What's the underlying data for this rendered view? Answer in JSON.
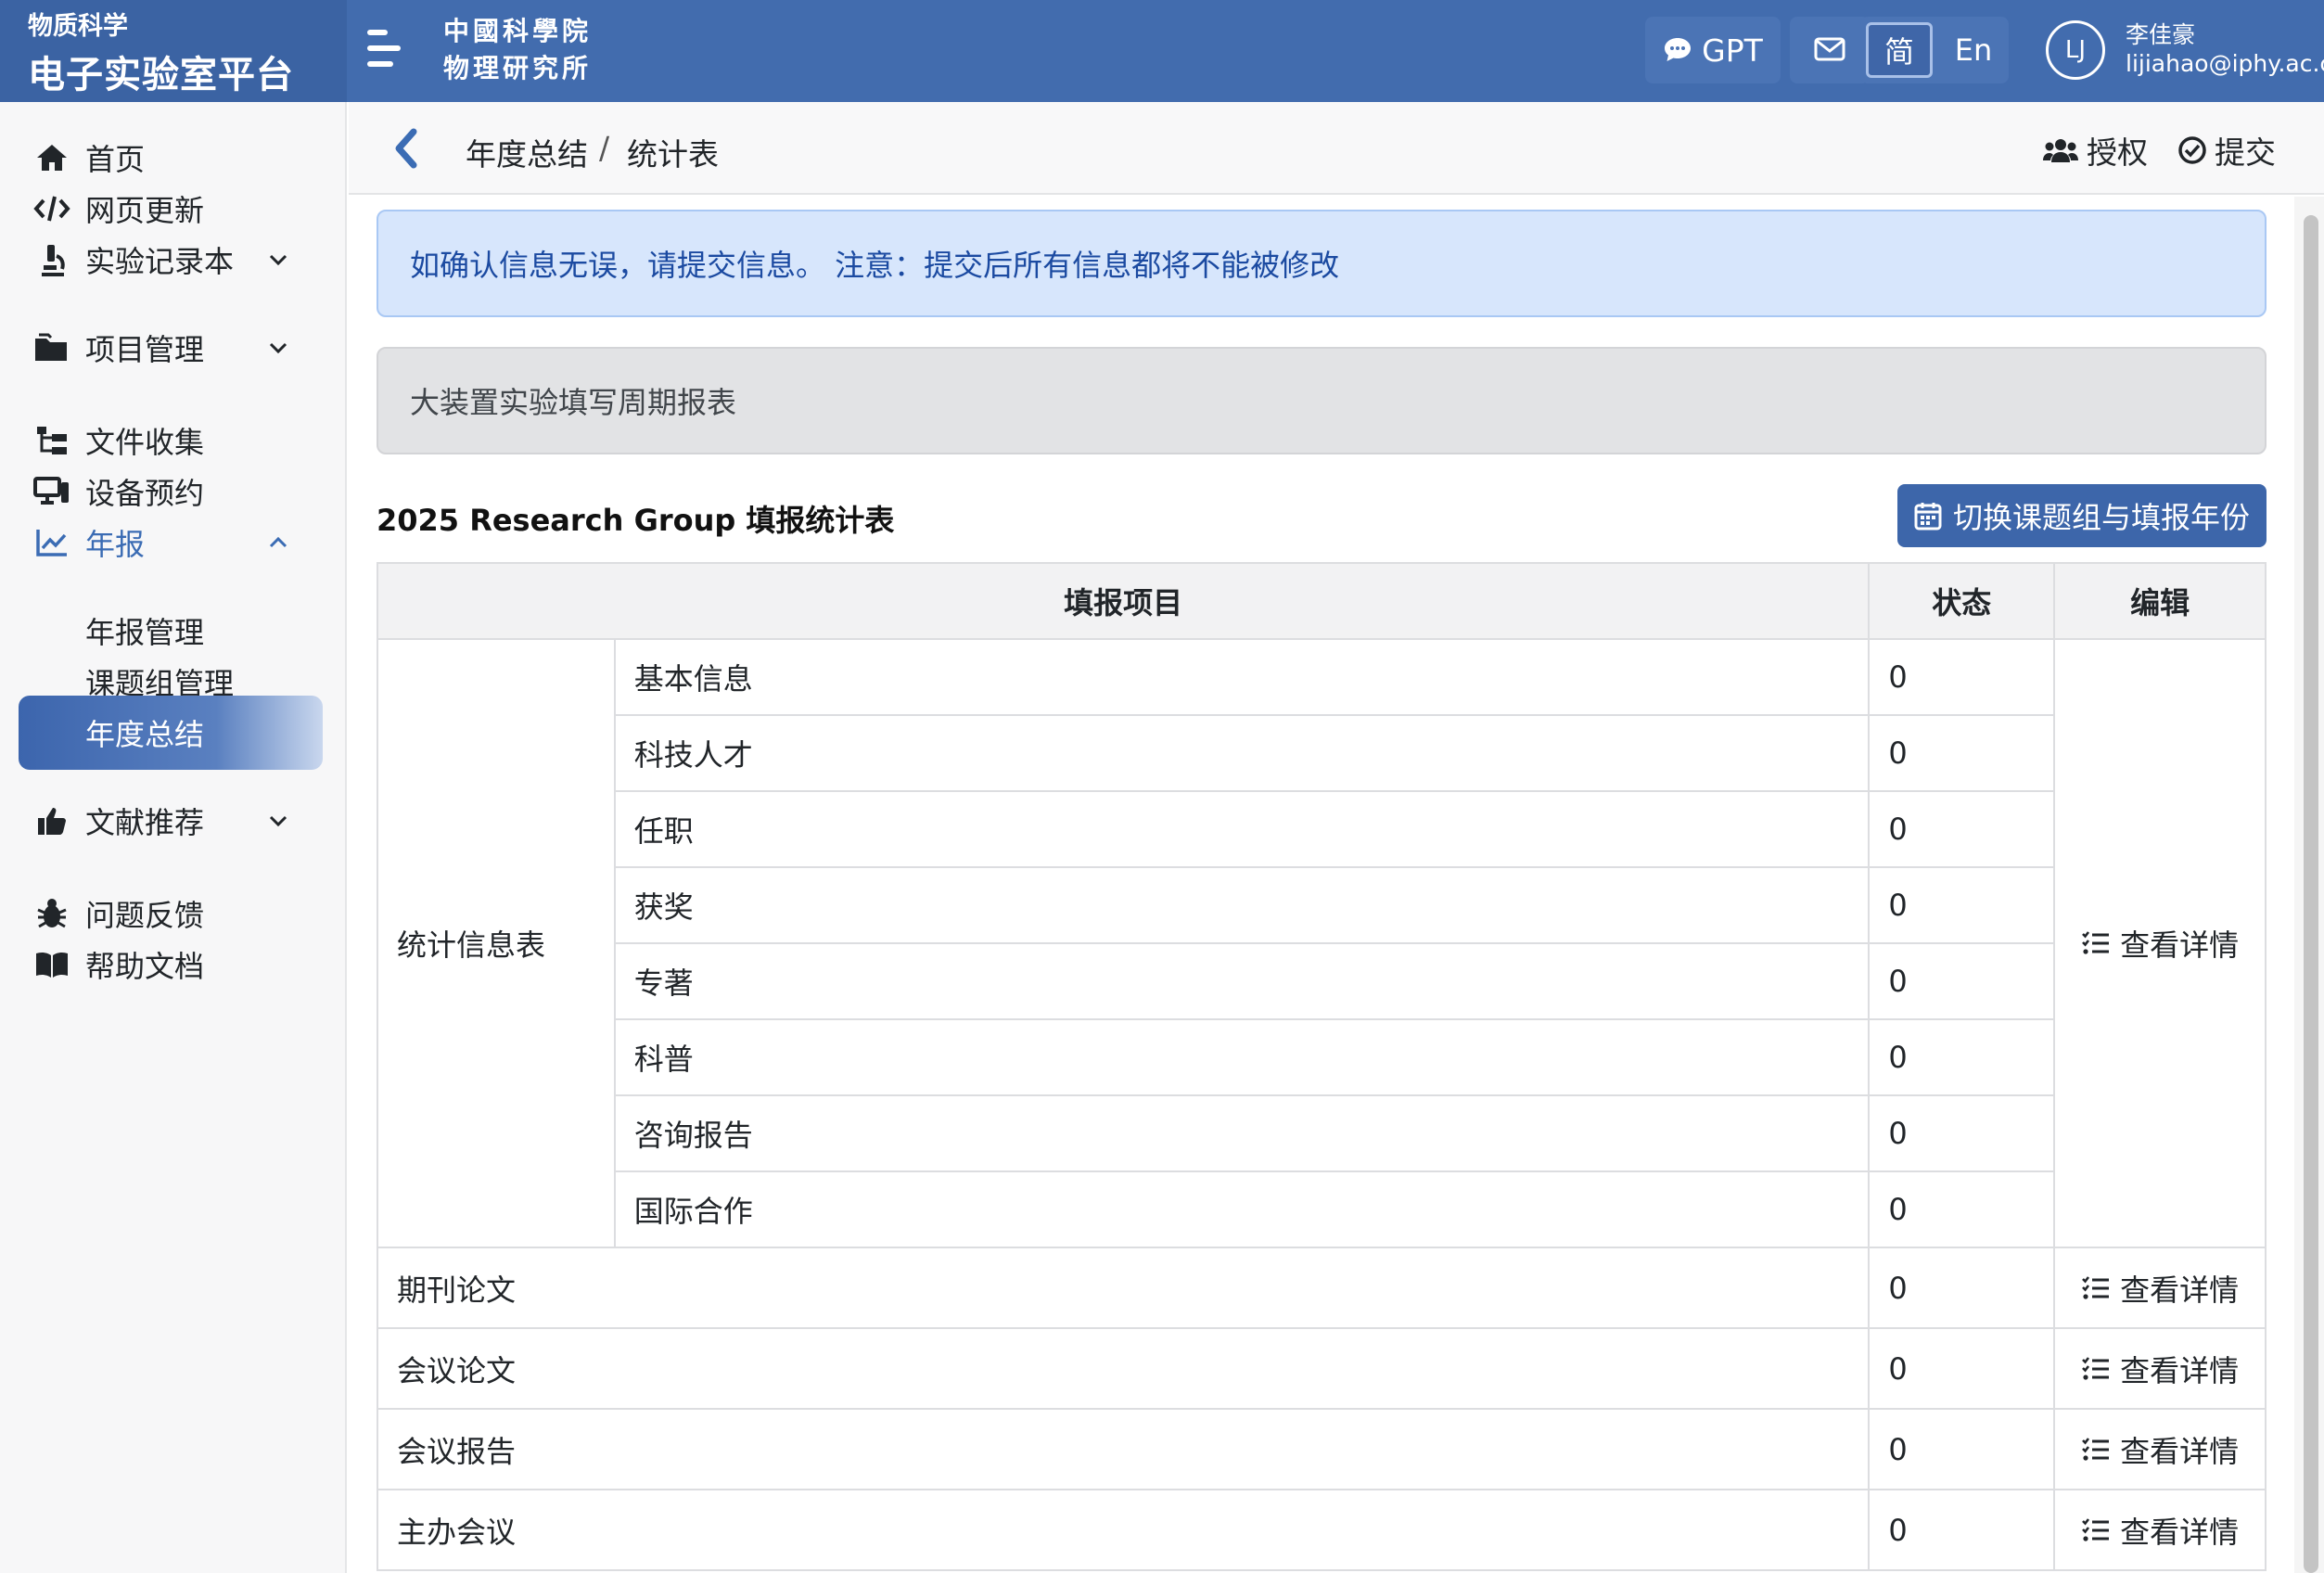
{
  "brand": {
    "subtitle": "物质科学",
    "title": "电子实验室平台"
  },
  "institute": {
    "line1": "中國科學院",
    "line2": "物理研究所"
  },
  "topbar": {
    "gpt_label": "GPT",
    "lang_zh": "简",
    "lang_en": "En",
    "active_lang": "简",
    "user_initials": "LJ",
    "user_name": "李佳豪",
    "user_email": "lijiahao@iphy.ac.cn"
  },
  "sidebar": {
    "items": [
      {
        "label": "首页",
        "icon": "home-icon"
      },
      {
        "label": "网页更新",
        "icon": "code-icon"
      },
      {
        "label": "实验记录本",
        "icon": "microscope-icon",
        "expandable": true
      },
      {
        "label": "项目管理",
        "icon": "folder-icon",
        "expandable": true
      },
      {
        "label": "文件收集",
        "icon": "tree-icon"
      },
      {
        "label": "设备预约",
        "icon": "devices-icon"
      },
      {
        "label": "年报",
        "icon": "chart-line-icon",
        "expanded": true
      },
      {
        "label": "文献推荐",
        "icon": "thumbs-up-icon",
        "expandable": true
      },
      {
        "label": "问题反馈",
        "icon": "bug-icon"
      },
      {
        "label": "帮助文档",
        "icon": "book-icon"
      }
    ],
    "sub_items": [
      {
        "label": "年报管理"
      },
      {
        "label": "课题组管理"
      },
      {
        "label": "年度总结",
        "active": true
      }
    ]
  },
  "header": {
    "breadcrumb": [
      "年度总结",
      "统计表"
    ],
    "separator": "/",
    "authorize_label": "授权",
    "submit_label": "提交"
  },
  "alerts": {
    "info": "如确认信息无误，请提交信息。 注意：提交后所有信息都将不能被修改",
    "gray": "大装置实验填写周期报表"
  },
  "table": {
    "title": "2025 Research Group 填报统计表",
    "switch_button": "切换课题组与填报年份",
    "headers": {
      "item": "填报项目",
      "status": "状态",
      "edit": "编辑"
    },
    "group_label": "统计信息表",
    "group_rows": [
      {
        "name": "基本信息",
        "status": "0"
      },
      {
        "name": "科技人才",
        "status": "0"
      },
      {
        "name": "任职",
        "status": "0"
      },
      {
        "name": "获奖",
        "status": "0"
      },
      {
        "name": "专著",
        "status": "0"
      },
      {
        "name": "科普",
        "status": "0"
      },
      {
        "name": "咨询报告",
        "status": "0"
      },
      {
        "name": "国际合作",
        "status": "0"
      }
    ],
    "single_rows": [
      {
        "name": "期刊论文",
        "status": "0"
      },
      {
        "name": "会议论文",
        "status": "0"
      },
      {
        "name": "会议报告",
        "status": "0"
      },
      {
        "name": "主办会议",
        "status": "0"
      }
    ],
    "detail_label": "查看详情"
  },
  "colors": {
    "topbar": "#426cae",
    "brand_bg": "#3b63a3",
    "accent": "#3b6cb4",
    "info_bg": "#d7e6fc",
    "info_text": "#1b4aa1"
  }
}
